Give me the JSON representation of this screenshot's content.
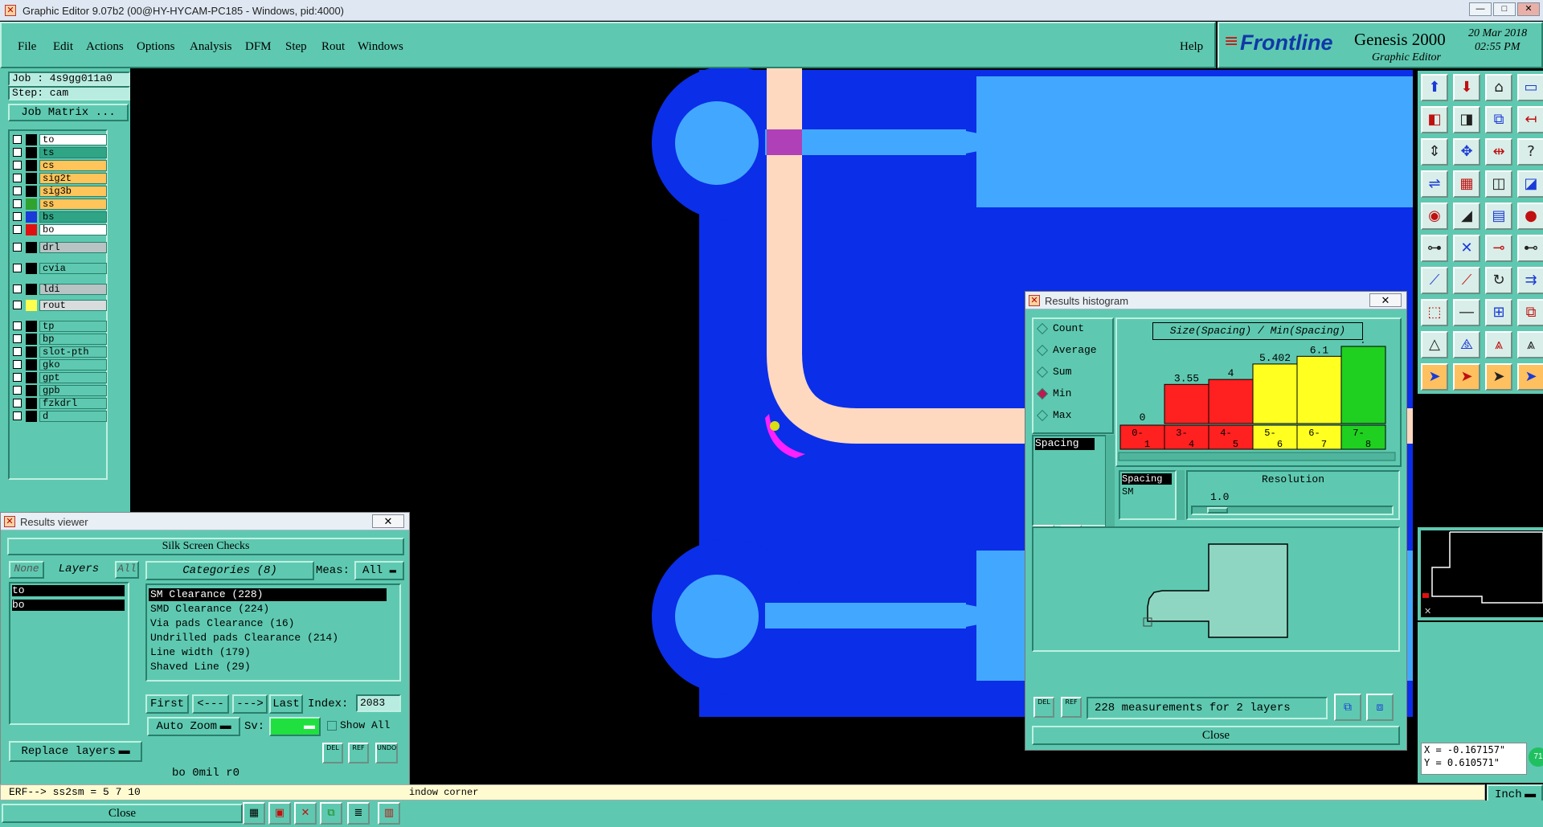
{
  "window": {
    "title": "Graphic Editor 9.07b2 (00@HY-HYCAM-PC185 - Windows, pid:4000)",
    "min": "—",
    "max": "□",
    "close": "✕"
  },
  "menu": [
    "File",
    "Edit",
    "Actions",
    "Options",
    "Analysis",
    "DFM",
    "Step",
    "Rout",
    "Windows"
  ],
  "help": "Help",
  "logo": {
    "brand": "Frontline",
    "product": "Genesis 2000",
    "sub": "Graphic Editor",
    "date": "20 Mar 2018",
    "time": "02:55 PM"
  },
  "job": {
    "job": "Job : 4s9gg011a0",
    "step": "Step: cam",
    "matrix_button": "Job Matrix ..."
  },
  "layers": [
    {
      "name": "to",
      "bg": "#ffffff",
      "swatch": "#000000",
      "selected": true
    },
    {
      "name": "ts",
      "bg": "#2fa586",
      "swatch": "#000000"
    },
    {
      "name": "cs",
      "bg": "#ffc45a",
      "swatch": "#000000"
    },
    {
      "name": "sig2t",
      "bg": "#ffc45a",
      "swatch": "#000000"
    },
    {
      "name": "sig3b",
      "bg": "#ffc45a",
      "swatch": "#000000"
    },
    {
      "name": "ss",
      "bg": "#ffc45a",
      "swatch": "#2fa22f"
    },
    {
      "name": "bs",
      "bg": "#2fa586",
      "swatch": "#1a3bd8"
    },
    {
      "name": "bo",
      "bg": "#ffffff",
      "swatch": "#e01010",
      "selected": true
    },
    {
      "name": "drl",
      "bg": "#b8c4c4",
      "swatch": "#000000"
    },
    {
      "name": "cvia",
      "bg": "#5ec9b0",
      "swatch": "#000000"
    },
    {
      "name": "ldi",
      "bg": "#b8c4c4",
      "swatch": "#000000"
    },
    {
      "name": "rout",
      "bg": "#d8dcdc",
      "swatch": "#ffff50"
    },
    {
      "name": "tp",
      "bg": "#5ec9b0",
      "swatch": "#000000"
    },
    {
      "name": "bp",
      "bg": "#5ec9b0",
      "swatch": "#000000"
    },
    {
      "name": "slot-pth",
      "bg": "#5ec9b0",
      "swatch": "#000000"
    },
    {
      "name": "gko",
      "bg": "#5ec9b0",
      "swatch": "#000000"
    },
    {
      "name": "gpt",
      "bg": "#5ec9b0",
      "swatch": "#000000"
    },
    {
      "name": "gpb",
      "bg": "#5ec9b0",
      "swatch": "#000000"
    },
    {
      "name": "fzkdrl",
      "bg": "#5ec9b0",
      "swatch": "#000000"
    },
    {
      "name": "d",
      "bg": "#5ec9b0",
      "swatch": "#000000"
    }
  ],
  "results_viewer": {
    "title": "Results viewer",
    "header": "Silk Screen Checks",
    "none": "None",
    "layers": "Layers",
    "all": "All",
    "layer_list": [
      "to",
      "bo"
    ],
    "categories_label": "Categories (8)",
    "meas_label": "Meas:",
    "meas_value": "All",
    "categories": [
      "SM Clearance (228)",
      "SMD Clearance (224)",
      "Via pads Clearance (16)",
      "Undrilled pads Clearance (214)",
      "Line width (179)",
      "Shaved Line (29)"
    ],
    "first": "First",
    "prev": "<---",
    "next": "--->",
    "last": "Last",
    "index_label": "Index:",
    "index_value": "2083",
    "auto_zoom": "Auto Zoom",
    "sv_label": "Sv:",
    "show_all": "Show All",
    "replace_layers": "Replace layers",
    "info": "bo 0mil  r0",
    "close": "Close",
    "del": "DEL",
    "ref": "REF",
    "undo": "UNDO"
  },
  "histogram": {
    "title": "Results histogram",
    "options": [
      "Count",
      "Average",
      "Sum",
      "Min",
      "Max"
    ],
    "selected_option": "Min",
    "list_item": "Spacing",
    "chart_title": "Size(Spacing) / Min(Spacing)",
    "bottom_list": [
      "Spacing",
      "SM"
    ],
    "resolution_label": "Resolution",
    "resolution_value": "1.0",
    "measurements": "228 measurements for 2 layers",
    "close": "Close",
    "del": "DEL",
    "ref": "REF"
  },
  "chart_data": {
    "type": "bar",
    "title": "Size(Spacing) / Min(Spacing)",
    "categories": [
      "0-1",
      "3-4",
      "4-5",
      "5-6",
      "6-7",
      "7-8"
    ],
    "values": [
      0,
      3.55,
      4,
      5.402,
      6.1,
      7
    ],
    "value_labels": [
      "0",
      "3.55",
      "4",
      "5.402",
      "6.1",
      "7"
    ],
    "colors": [
      "#ff2020",
      "#ff2020",
      "#ff2020",
      "#ffff20",
      "#ffff20",
      "#20d020"
    ],
    "ylim": [
      0,
      7
    ]
  },
  "cmdline": {
    "text": "ERF--> ss2sm = 5 7 10",
    "prompt": "indow corner"
  },
  "coords": {
    "x": "X = -0.167157\"",
    "y": "Y = 0.610571\""
  },
  "units": "Inch",
  "zoom_badge": "71"
}
